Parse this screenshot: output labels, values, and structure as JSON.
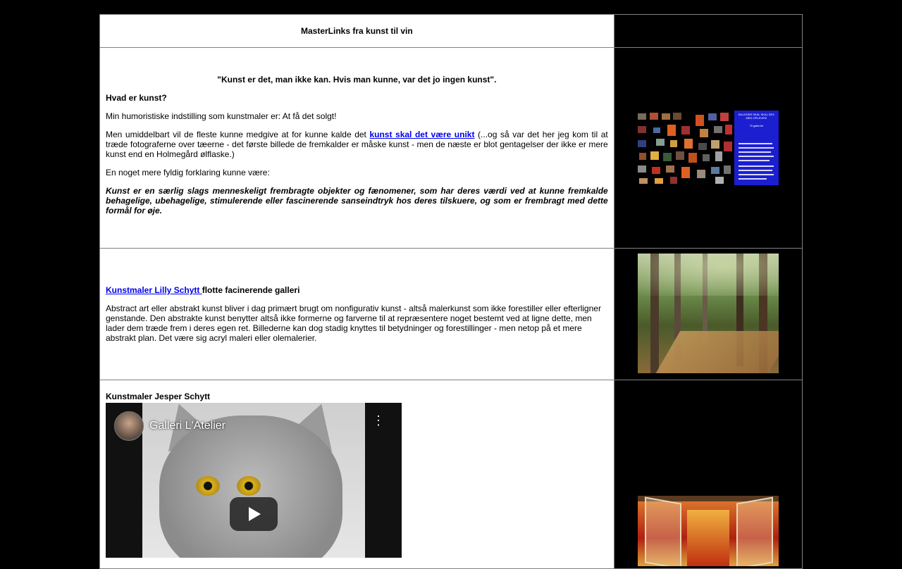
{
  "header": {
    "title": "MasterLinks fra kunst til vin"
  },
  "section1": {
    "quote": "\"Kunst er det, man ikke kan. Hvis man kunne, var det jo ingen kunst\".",
    "heading": "Hvad er kunst?",
    "p1": "Min humoristiske indstilling som kunstmaler er: At få det solgt!",
    "p2_before": "Men umiddelbart vil de fleste kunne medgive at for kunne kalde det ",
    "p2_link": "kunst skal det være unikt",
    "p2_after": " (...og så var det her jeg kom til at træde fotograferne over tæerne - det første billede de fremkalder er måske kunst - men de næste er blot gentagelser der ikke er mere kunst end en Holmegård ølflaske.)",
    "p3": "En noget mere fyldig forklaring kunne være:",
    "p4": "Kunst er en særlig slags menneskeligt frembragte objekter og fænomener, som har deres værdi ved at kunne fremkalde behagelige, ubehagelige, stimulerende eller fascinerende sanseindtryk hos deres tilskuere, og som er frembragt med dette formål for øje.",
    "collage_text": {
      "line1": "BILLEDER SKAL SKAL SES",
      "line2": "MED OPLEVES!",
      "line3": "Til galleriet"
    }
  },
  "section2": {
    "link": "Kunstmaler Lilly Schytt ",
    "link_suffix": "flotte facinerende galleri",
    "body": "Abstract art eller abstrakt kunst bliver i dag primært brugt om nonfigurativ kunst - altså malerkunst som ikke forestiller eller efterligner genstande. Den abstrakte kunst benytter altså ikke formerne og farverne til at repræsentere noget bestemt ved at ligne dette, men lader dem træde frem i deres egen ret. Billederne kan dog stadig knyttes til betydninger og forestillinger - men netop på et mere abstrakt plan. Det være sig acryl maleri eller olemalerier."
  },
  "section3": {
    "heading": "Kunstmaler Jesper Schytt",
    "video_title": "Galleri L'Atelier",
    "menu_glyph": "⋮"
  },
  "colors": {
    "page_bg": "#000000",
    "cell_bg": "#ffffff",
    "link": "#0000ee",
    "collage_blue": "#1b1fd0"
  }
}
